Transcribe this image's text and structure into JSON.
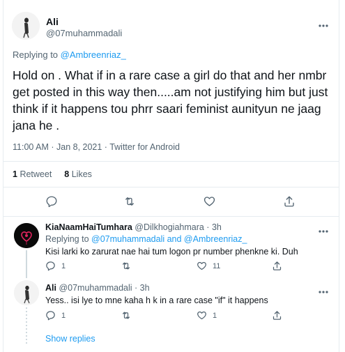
{
  "tweet": {
    "author_name": "Ali",
    "author_handle": "@07muhammadali",
    "replying_prefix": "Replying to",
    "replying_to": "@Ambreenriaz_",
    "body": "Hold on . What if in a rare case a girl do that and her nmbr get posted in this way then.....am not justifying him but just think if it happens tou phrr saari feminist aunityun ne jaag jana he .",
    "meta": "11:00 AM · Jan 8, 2021 · Twitter for Android",
    "retweets_count": "1",
    "retweets_label": "Retweet",
    "likes_count": "8",
    "likes_label": "Likes"
  },
  "replies": [
    {
      "author_name": "KiaNaamHaiTumhara",
      "author_handle": "@Dilkhogiahmara · 3h",
      "replying_prefix": "Replying to",
      "replying_to": "@07muhammadali and @Ambreenriaz_",
      "body": "Kisi larki ko zarurat nae hai tum logon pr number phenkne ki. Duh",
      "replies_count": "1",
      "likes_count": "11"
    },
    {
      "author_name": "Ali",
      "author_handle": "@07muhammadali · 3h",
      "body": "Yess.. isi lye to mne kaha h k in a rare case \"if\" it happens",
      "replies_count": "1",
      "likes_count": "1"
    }
  ],
  "show_replies_label": "Show replies",
  "colors": {
    "accent": "#1d9bf0",
    "muted": "#536471",
    "text": "#0f1419",
    "border": "#e6ecf0"
  }
}
